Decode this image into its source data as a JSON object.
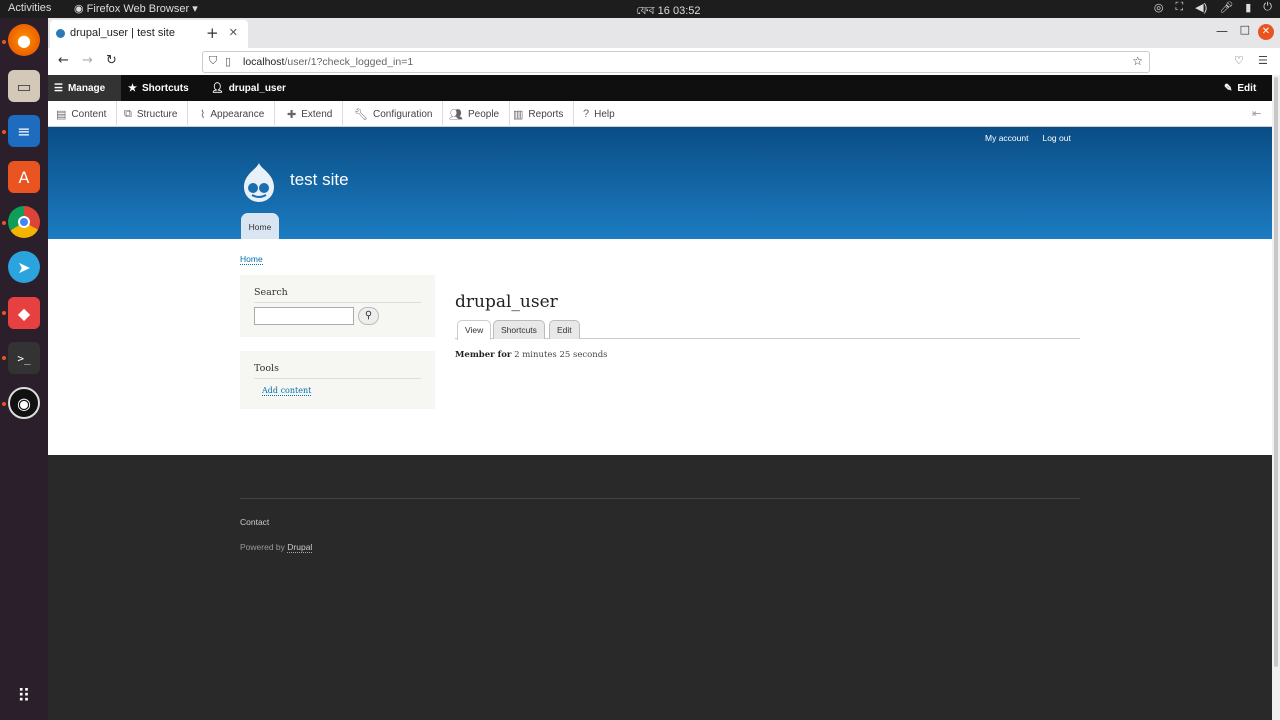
{
  "system": {
    "activities": "Activities",
    "app_name": "Firefox Web Browser ▾",
    "clock": "ফেব 16  03:52"
  },
  "browser": {
    "tab_title": "drupal_user | test site",
    "url_host": "localhost",
    "url_path": "/user/1?check_logged_in=1"
  },
  "toolbar": {
    "manage": "Manage",
    "shortcuts": "Shortcuts",
    "user": "drupal_user",
    "edit": "Edit"
  },
  "admin_menu": {
    "content": "Content",
    "structure": "Structure",
    "appearance": "Appearance",
    "extend": "Extend",
    "configuration": "Configuration",
    "people": "People",
    "reports": "Reports",
    "help": "Help"
  },
  "header": {
    "my_account": "My account",
    "log_out": "Log out",
    "site_name": "test site",
    "home_tab": "Home"
  },
  "breadcrumb": {
    "home": "Home"
  },
  "sidebar": {
    "search_title": "Search",
    "tools_title": "Tools",
    "add_content": "Add content"
  },
  "main": {
    "title": "drupal_user",
    "tabs": {
      "view": "View",
      "shortcuts": "Shortcuts",
      "edit": "Edit"
    },
    "member_label": "Member for",
    "member_value": "2 minutes 25 seconds"
  },
  "footer": {
    "contact": "Contact",
    "powered_by": "Powered by",
    "drupal": "Drupal"
  },
  "colors": {
    "header_top": "#0a4d86",
    "header_bottom": "#1c7cc1",
    "link": "#0071b3",
    "footer_bg": "#292929",
    "toolbar_bg": "#0f0f0f"
  }
}
